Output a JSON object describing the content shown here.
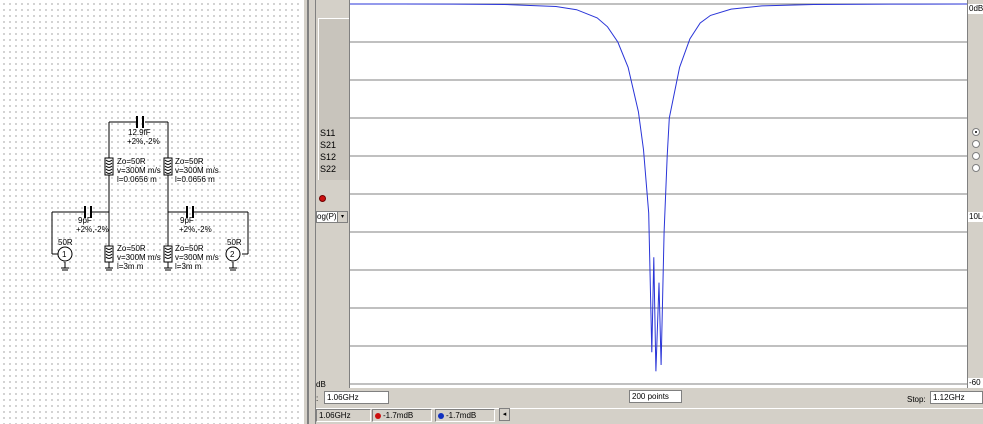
{
  "schematic": {
    "series_cap": {
      "value": "12.9fF",
      "tol": "+2%,-2%"
    },
    "line_left_top": {
      "zo": "Zo=50R",
      "v": "v=300M m/s",
      "l": "l=0.0656 m"
    },
    "line_right_top": {
      "zo": "Zo=50R",
      "v": "v=300M m/s",
      "l": "l=0.0656 m"
    },
    "cap_left": {
      "value": "9pF",
      "tol": "+2%,-2%"
    },
    "cap_right": {
      "value": "9pF",
      "tol": "+2%,-2%"
    },
    "line_left_bottom": {
      "zo": "Zo=50R",
      "v": "v=300M m/s",
      "l": "l=3m m"
    },
    "line_right_bottom": {
      "zo": "Zo=50R",
      "v": "v=300M m/s",
      "l": "l=3m m"
    },
    "port1": {
      "impedance": "50R",
      "number": "1"
    },
    "port2": {
      "impedance": "50R",
      "number": "2"
    }
  },
  "sparams": [
    "S11",
    "S21",
    "S12",
    "S22"
  ],
  "scale_select": {
    "value": "og(P)",
    "arrow": "▾"
  },
  "axis": {
    "top": "0dB",
    "per_div": "10Lo",
    "bottom": "-60",
    "ymin_label": "dB"
  },
  "controls": {
    "start_prefix": ":",
    "start": "1.06GHz",
    "points": "200 points",
    "stop_label": "Stop:",
    "stop": "1.12GHz"
  },
  "status": {
    "freq": "1.06GHz",
    "marker_red": "-1.7mdB",
    "marker_blue": "-1.7mdB",
    "scroll_arrow": "◂"
  },
  "colors": {
    "trace": "#2a35d8",
    "marker_red": "#cc1010",
    "marker_blue": "#1030c0",
    "grid": "#808080"
  },
  "chart_data": {
    "type": "line",
    "x_unit": "GHz",
    "xlim": [
      1.06,
      1.12
    ],
    "ylim": [
      -60,
      0
    ],
    "y_unit": "dB",
    "points": 200,
    "series": [
      {
        "x": [
          1.06,
          1.065,
          1.07,
          1.075,
          1.08,
          1.082,
          1.084,
          1.085,
          1.086,
          1.087,
          1.088,
          1.0885,
          1.089,
          1.0893,
          1.0895,
          1.0897,
          1.09,
          1.0902,
          1.0905,
          1.0908,
          1.091,
          1.092,
          1.093,
          1.094,
          1.095,
          1.097,
          1.1,
          1.105,
          1.11,
          1.115,
          1.12
        ],
        "y": [
          0,
          0,
          -0.02,
          -0.08,
          -0.4,
          -0.9,
          -2.2,
          -3.6,
          -6,
          -10,
          -17,
          -23,
          -33,
          -55,
          -40,
          -58,
          -44,
          -57,
          -36,
          -24,
          -18,
          -10,
          -5.5,
          -3,
          -1.8,
          -0.8,
          -0.3,
          -0.08,
          -0.03,
          -0.01,
          0
        ]
      }
    ]
  }
}
